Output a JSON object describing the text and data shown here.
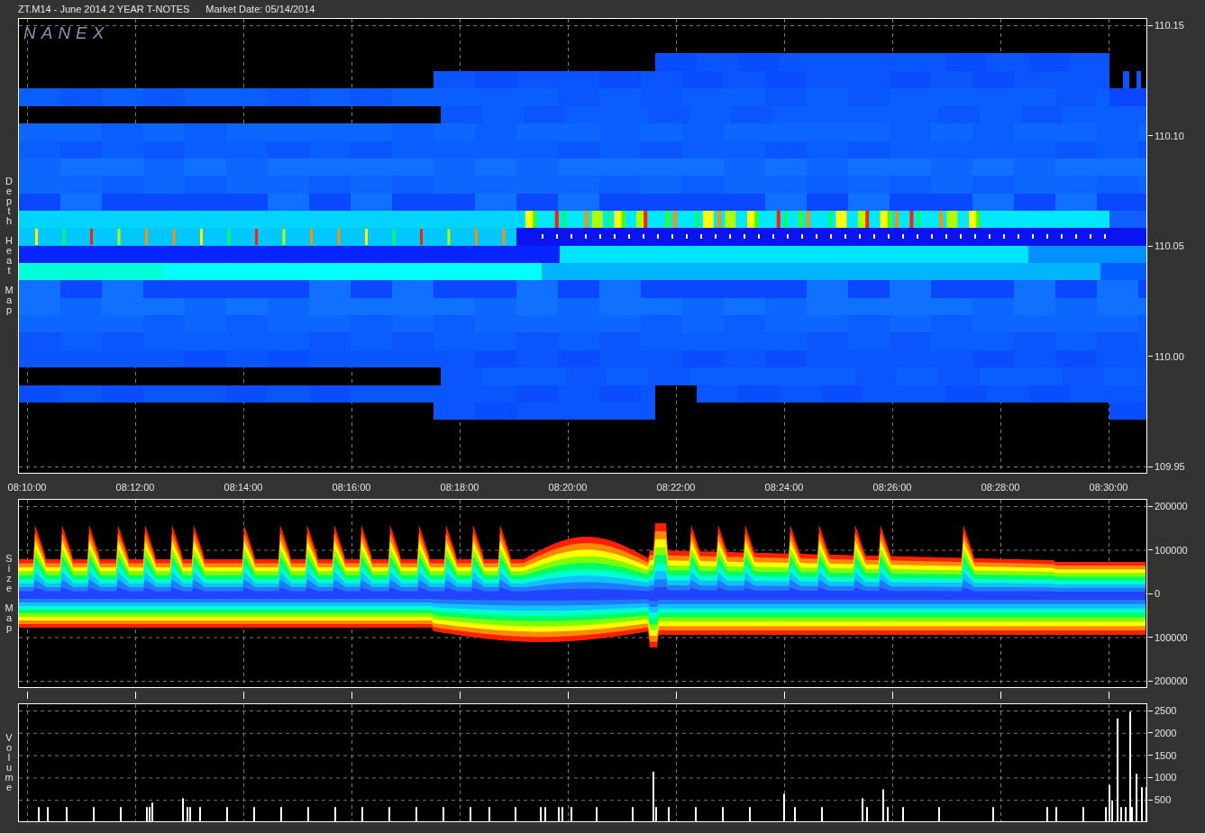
{
  "header": {
    "symbol": "ZT.M14 - June 2014 2 YEAR T-NOTES",
    "market_date": "Market Date: 05/14/2014"
  },
  "heat_map": {
    "title": "Depth Heat Map",
    "logo": "NANEX",
    "price_axis": [
      "110.15",
      "110.10",
      "110.05",
      "110.00",
      "109.95"
    ]
  },
  "time_axis": [
    "08:10:00",
    "08:12:00",
    "08:14:00",
    "08:16:00",
    "08:18:00",
    "08:20:00",
    "08:22:00",
    "08:24:00",
    "08:26:00",
    "08:28:00",
    "08:30:00"
  ],
  "size_map": {
    "title": "Size Map",
    "axis": [
      "200000",
      "100000",
      "0",
      "100000",
      "200000"
    ]
  },
  "volume": {
    "title": "Volume",
    "axis": [
      "2500",
      "2000",
      "1500",
      "1000",
      "500"
    ]
  }
}
